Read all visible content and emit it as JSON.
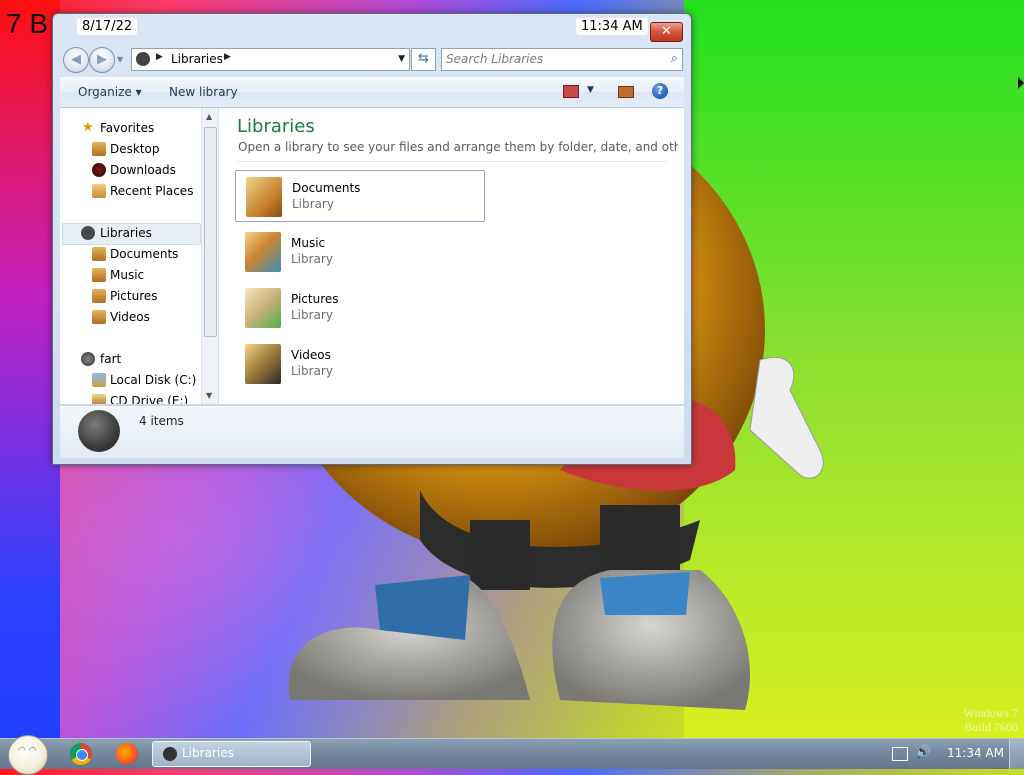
{
  "desktop": {
    "corner_text": "7 B",
    "watermark_line1": "Windows 7",
    "watermark_line2": "Build 7600"
  },
  "window": {
    "title_date": "8/17/22",
    "title_time": "11:34 AM",
    "close_label": "✕",
    "address": {
      "root_label": "Libraries"
    },
    "search": {
      "placeholder": "Search Libraries"
    },
    "toolbar": {
      "organize_label": "Organize ▾",
      "new_library_label": "New library",
      "help_label": "?"
    },
    "navigation": {
      "favorites": {
        "label": "Favorites",
        "items": [
          "Desktop",
          "Downloads",
          "Recent Places"
        ]
      },
      "libraries": {
        "label": "Libraries",
        "items": [
          "Documents",
          "Music",
          "Pictures",
          "Videos"
        ]
      },
      "computer": {
        "label": "fart",
        "items": [
          "Local Disk (C:)",
          "CD Drive (E:)"
        ]
      }
    },
    "main": {
      "title": "Libraries",
      "subtitle": "Open a library to see your files and arrange them by folder, date, and other pr...",
      "items": [
        {
          "name": "Documents",
          "type": "Library"
        },
        {
          "name": "Music",
          "type": "Library"
        },
        {
          "name": "Pictures",
          "type": "Library"
        },
        {
          "name": "Videos",
          "type": "Library"
        }
      ]
    },
    "details": {
      "count_text": "4 items"
    }
  },
  "taskbar": {
    "active_task_label": "Libraries",
    "clock": "11:34 AM"
  }
}
